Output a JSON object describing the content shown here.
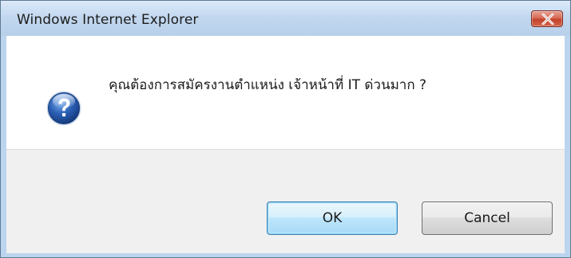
{
  "dialog": {
    "title": "Windows Internet Explorer",
    "message": "คุณต้องการสมัครงานตำแหน่ง เจ้าหน้าที่ IT ด่วนมาก ?",
    "icon": "question-icon",
    "buttons": {
      "ok_label": "OK",
      "cancel_label": "Cancel"
    }
  },
  "colors": {
    "frame": "#bcd5ef",
    "close_button": "#c1422c",
    "default_button_border": "#3c7fb1",
    "question_icon": "#2a5fb5"
  }
}
